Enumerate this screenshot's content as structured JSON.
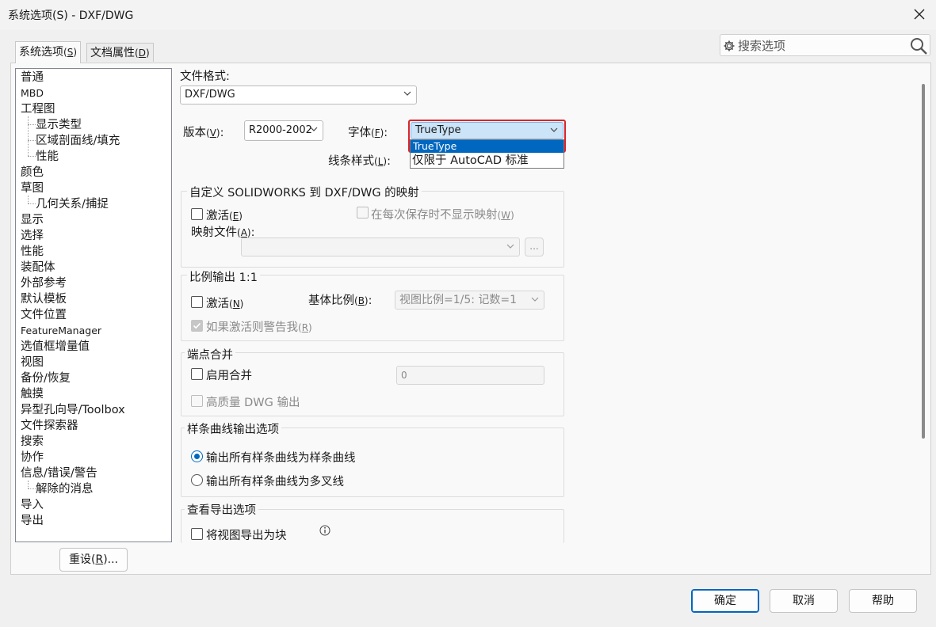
{
  "window": {
    "title": "系统选项(S) - DXF/DWG",
    "close_label": "✕"
  },
  "tabs": [
    {
      "label": "系统选项",
      "hotkey": "S",
      "active": true
    },
    {
      "label": "文档属性",
      "hotkey": "D",
      "active": false
    }
  ],
  "search": {
    "placeholder": "搜索选项"
  },
  "tree": {
    "items": [
      {
        "label": "普通",
        "level": 0
      },
      {
        "label": "MBD",
        "level": 0
      },
      {
        "label": "工程图",
        "level": 0
      },
      {
        "label": "显示类型",
        "level": 1
      },
      {
        "label": "区域剖面线/填充",
        "level": 1
      },
      {
        "label": "性能",
        "level": 1
      },
      {
        "label": "颜色",
        "level": 0
      },
      {
        "label": "草图",
        "level": 0
      },
      {
        "label": "几何关系/捕捉",
        "level": 1
      },
      {
        "label": "显示",
        "level": 0
      },
      {
        "label": "选择",
        "level": 0
      },
      {
        "label": "性能",
        "level": 0
      },
      {
        "label": "装配体",
        "level": 0
      },
      {
        "label": "外部参考",
        "level": 0
      },
      {
        "label": "默认模板",
        "level": 0
      },
      {
        "label": "文件位置",
        "level": 0
      },
      {
        "label": "FeatureManager",
        "level": 0
      },
      {
        "label": "选值框增量值",
        "level": 0
      },
      {
        "label": "视图",
        "level": 0
      },
      {
        "label": "备份/恢复",
        "level": 0
      },
      {
        "label": "触摸",
        "level": 0
      },
      {
        "label": "异型孔向导/Toolbox",
        "level": 0
      },
      {
        "label": "文件探索器",
        "level": 0
      },
      {
        "label": "搜索",
        "level": 0
      },
      {
        "label": "协作",
        "level": 0
      },
      {
        "label": "信息/错误/警告",
        "level": 0
      },
      {
        "label": "解除的消息",
        "level": 1
      },
      {
        "label": "导入",
        "level": 0
      },
      {
        "label": "导出",
        "level": 0
      }
    ]
  },
  "reset_button": {
    "label": "重设",
    "hotkey": "R",
    "suffix": "..."
  },
  "main": {
    "file_format_label": "文件格式:",
    "file_format_value": "DXF/DWG",
    "version_label": "版本",
    "version_hotkey": "V",
    "version_value": "R2000-2002",
    "font_label": "字体",
    "font_hotkey": "F",
    "font_value": "TrueType",
    "font_options": [
      "TrueType",
      "仅限于 AutoCAD 标准"
    ],
    "line_style_label": "线条样式",
    "line_style_hotkey": "L",
    "mapping_group": {
      "title": "自定义 SOLIDWORKS 到 DXF/DWG 的映射",
      "activate_label": "激活",
      "activate_hotkey": "E",
      "no_show_label": "在每次保存时不显示映射",
      "no_show_hotkey": "W",
      "map_file_label": "映射文件",
      "map_file_hotkey": "A",
      "browse_label": "..."
    },
    "scale_group": {
      "title": "比例输出 1:1",
      "activate_label": "激活",
      "activate_hotkey": "N",
      "base_scale_label": "基体比例",
      "base_scale_hotkey": "B",
      "base_scale_value": "视图比例=1/5: 记数=1",
      "warn_label": "如果激活则警告我",
      "warn_hotkey": "R"
    },
    "merge_group": {
      "title": "端点合并",
      "enable_label": "启用合并",
      "merge_value": "0",
      "hq_label": "高质量 DWG 输出"
    },
    "spline_group": {
      "title": "样条曲线输出选项",
      "opt1": "输出所有样条曲线为样条曲线",
      "opt2": "输出所有样条曲线为多叉线"
    },
    "view_export_group": {
      "title": "查看导出选项",
      "export_block_label": "将视图导出为块",
      "info_icon": "info-icon"
    }
  },
  "footer": {
    "ok_label": "确定",
    "cancel_label": "取消",
    "help_label": "帮助"
  },
  "colors": {
    "accent": "#0067c0",
    "dropdown_highlight": "#0067c0",
    "focus_border": "#d9252b"
  }
}
